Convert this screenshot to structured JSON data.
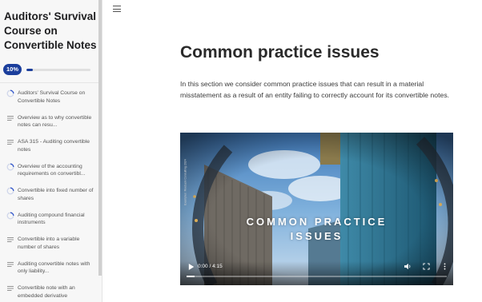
{
  "course": {
    "title": "Auditors' Survival Course on Convertible Notes",
    "progress_label": "10%",
    "progress_fraction": 0.1
  },
  "lessons": [
    {
      "label": "Auditors' Survival Course on Convertible Notes",
      "icon": "progress-circle-icon"
    },
    {
      "label": "Overview as to why convertible notes can resu...",
      "icon": "text-lines-icon"
    },
    {
      "label": "ASA 315 - Auditing convertible notes",
      "icon": "text-lines-icon"
    },
    {
      "label": "Overview of the accounting requirements on convertibl...",
      "icon": "progress-circle-icon"
    },
    {
      "label": "Convertible into fixed number of shares",
      "icon": "progress-circle-icon"
    },
    {
      "label": "Auditing compound financial instruments",
      "icon": "progress-circle-icon"
    },
    {
      "label": "Convertible into a variable number of shares",
      "icon": "text-lines-icon"
    },
    {
      "label": "Auditing convertible notes with only liability...",
      "icon": "text-lines-icon"
    },
    {
      "label": "Convertible note with an embedded derivative",
      "icon": "text-lines-icon"
    }
  ],
  "main": {
    "menu_icon": "hamburger-menu-icon",
    "heading": "Common practice issues",
    "intro": "In this section we consider common practice issues that can result in a material misstatement as a result of an entity failing to correctly account for its convertible notes."
  },
  "video": {
    "overlay_line1": "COMMON PRACTICE",
    "overlay_line2": "ISSUES",
    "side_text": "Examples: Roebuck Consulting 2024",
    "time": "0:00 / 4:15",
    "played_fraction": 0.03,
    "controls": [
      "play-icon",
      "volume-icon",
      "fullscreen-icon",
      "more-options-icon"
    ]
  },
  "colors": {
    "accent": "#1b3e9c",
    "progress_circle": "#2f54c9"
  }
}
